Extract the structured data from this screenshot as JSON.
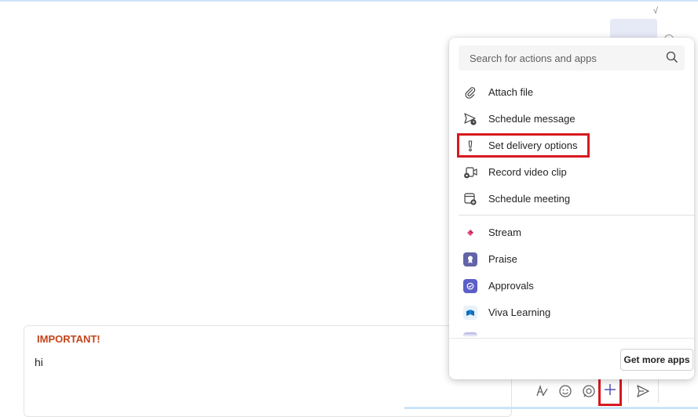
{
  "background": {
    "bubble_dots": "....."
  },
  "compose": {
    "importance_label": "IMPORTANT!",
    "message_text": "hi",
    "toolbar": {
      "format_icon": "format-icon",
      "emoji_icon": "emoji-icon",
      "loop_icon": "loop-icon",
      "plus_icon": "plus-icon",
      "send_icon": "send-icon"
    }
  },
  "popup": {
    "search": {
      "placeholder": "Search for actions and apps"
    },
    "actions": [
      {
        "label": "Attach file",
        "icon": "paperclip-icon"
      },
      {
        "label": "Schedule message",
        "icon": "schedule-send-icon"
      },
      {
        "label": "Set delivery options",
        "icon": "exclamation-icon"
      },
      {
        "label": "Record video clip",
        "icon": "video-record-icon"
      },
      {
        "label": "Schedule meeting",
        "icon": "calendar-add-icon"
      }
    ],
    "apps": [
      {
        "label": "Stream",
        "icon": "stream-icon",
        "color": "#e3477b"
      },
      {
        "label": "Praise",
        "icon": "praise-icon",
        "color": "#6264a7"
      },
      {
        "label": "Approvals",
        "icon": "approvals-icon",
        "color": "#5b5fc7"
      },
      {
        "label": "Viva Learning",
        "icon": "viva-learning-icon",
        "color": "#0f6cbd"
      }
    ],
    "get_more_label": "Get more apps"
  },
  "highlight_color": "#d71920",
  "importance_color": "#c4441c"
}
